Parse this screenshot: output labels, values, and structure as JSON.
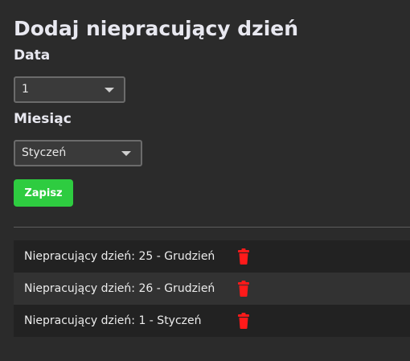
{
  "header": {
    "title": "Dodaj niepracujący dzień"
  },
  "form": {
    "day_label": "Data",
    "day_value": "1",
    "month_label": "Miesiąc",
    "month_value": "Styczeń",
    "save_label": "Zapisz"
  },
  "holidays": [
    {
      "label": "Niepracujący dzień: 25 - Grudzień",
      "delete_icon": "trash-icon"
    },
    {
      "label": "Niepracujący dzień: 26 - Grudzień",
      "delete_icon": "trash-icon"
    },
    {
      "label": "Niepracujący dzień: 1 - Styczeń",
      "delete_icon": "trash-icon"
    }
  ],
  "colors": {
    "background": "#2b2b2b",
    "save_button": "#2ecc40",
    "delete_icon": "#ff1a1a"
  }
}
